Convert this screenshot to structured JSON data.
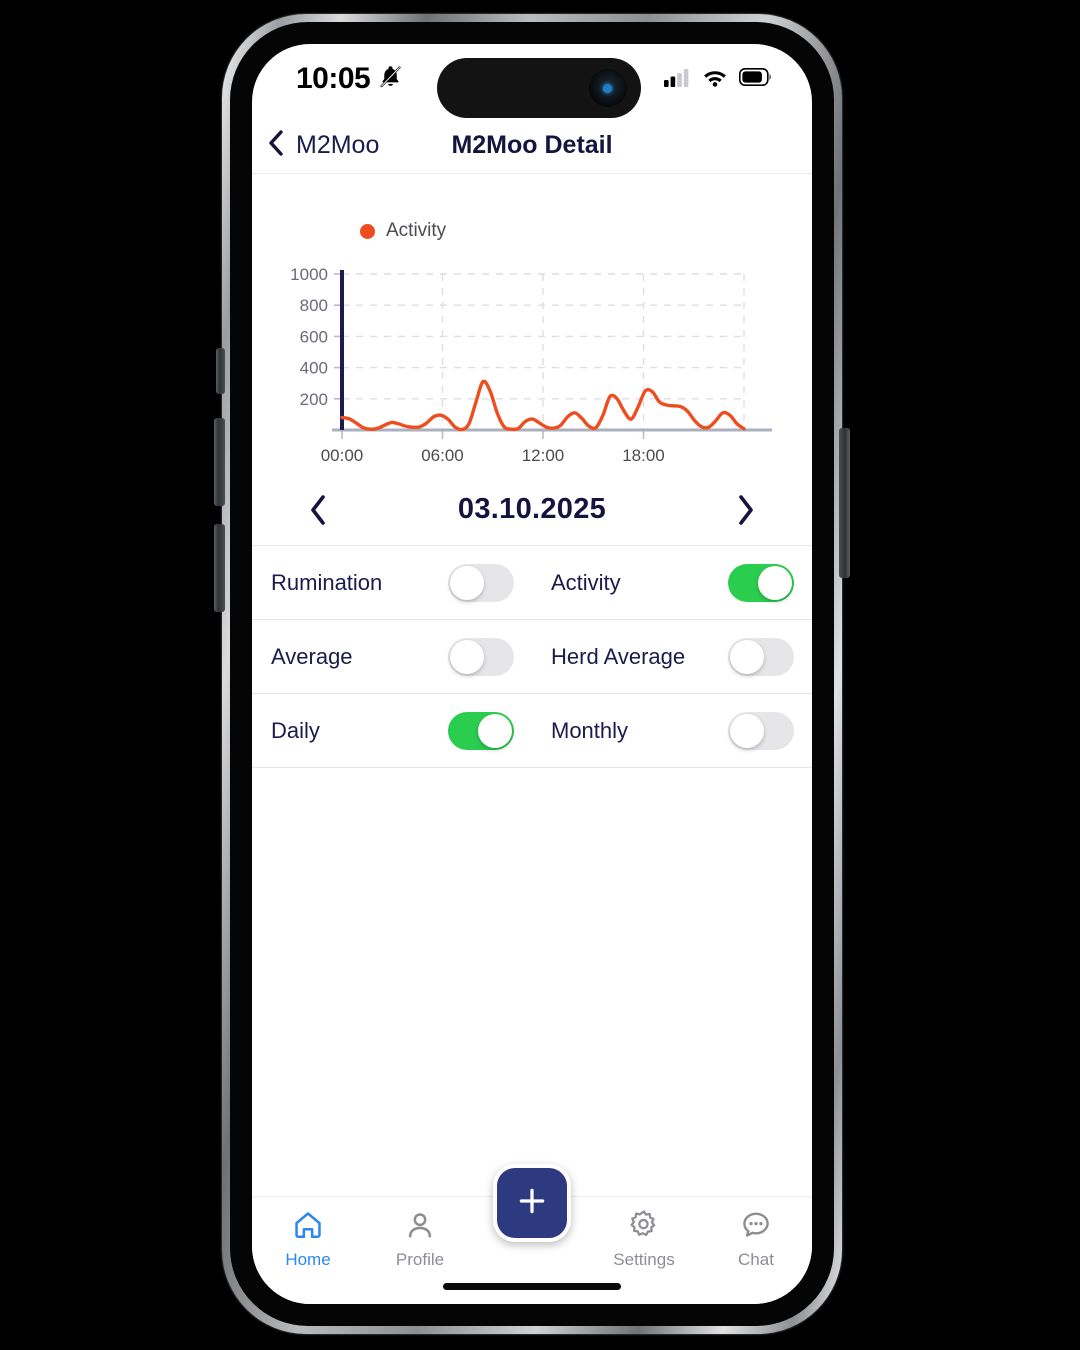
{
  "status_bar": {
    "time": "10:05",
    "bell_icon": "bell-muted-icon",
    "signal_icon": "cellular-signal-icon",
    "wifi_icon": "wifi-icon",
    "battery_icon": "battery-icon"
  },
  "nav": {
    "back_icon": "chevron-left-icon",
    "back_label": "M2Moo",
    "title": "M2Moo Detail"
  },
  "chart_card": {
    "legend_label": "Activity",
    "legend_color": "#ee4d1f"
  },
  "date_selector": {
    "prev_icon": "chevron-left-icon",
    "next_icon": "chevron-right-icon",
    "date": "03.10.2025"
  },
  "toggles": {
    "rows": [
      {
        "left": {
          "label": "Rumination",
          "on": false
        },
        "right": {
          "label": "Activity",
          "on": true
        }
      },
      {
        "left": {
          "label": "Average",
          "on": false
        },
        "right": {
          "label": "Herd Average",
          "on": false
        }
      },
      {
        "left": {
          "label": "Daily",
          "on": true
        },
        "right": {
          "label": "Monthly",
          "on": false
        }
      }
    ],
    "on_color": "#2bcd4f",
    "off_color": "#e6e6e8"
  },
  "tab_bar": {
    "items": [
      {
        "label": "Home",
        "icon": "home-icon",
        "active": true
      },
      {
        "label": "Profile",
        "icon": "person-icon",
        "active": false
      },
      {
        "label": "",
        "icon": "plus-icon",
        "active": false
      },
      {
        "label": "Settings",
        "icon": "gear-icon",
        "active": false
      },
      {
        "label": "Chat",
        "icon": "chat-bubble-icon",
        "active": false
      }
    ],
    "active_color": "#2e86f0",
    "inactive_color": "#8d8d96",
    "fab_color": "#2d3a80",
    "fab_icon": "plus-icon"
  },
  "chart_data": {
    "type": "line",
    "title": "",
    "xlabel": "",
    "ylabel": "",
    "series": [
      {
        "name": "Activity",
        "color": "#ee4d1f",
        "values": [
          80,
          72,
          45,
          15,
          5,
          10,
          30,
          48,
          40,
          25,
          18,
          20,
          45,
          85,
          95,
          70,
          20,
          3,
          40,
          180,
          310,
          250,
          110,
          20,
          5,
          10,
          55,
          70,
          45,
          18,
          12,
          30,
          85,
          110,
          75,
          25,
          15,
          95,
          215,
          200,
          120,
          70,
          150,
          250,
          245,
          180,
          160,
          155,
          150,
          120,
          60,
          20,
          18,
          60,
          110,
          95,
          40,
          8
        ]
      }
    ],
    "x": [
      "00:00",
      "00:25",
      "00:50",
      "01:15",
      "01:40",
      "02:05",
      "02:30",
      "02:55",
      "03:20",
      "03:45",
      "04:10",
      "04:35",
      "05:00",
      "05:25",
      "05:50",
      "06:15",
      "06:40",
      "07:05",
      "07:30",
      "07:55",
      "08:20",
      "08:45",
      "09:10",
      "09:35",
      "10:00",
      "10:25",
      "10:50",
      "11:15",
      "11:40",
      "12:05",
      "12:30",
      "12:55",
      "13:20",
      "13:45",
      "14:10",
      "14:35",
      "15:00",
      "15:25",
      "15:50",
      "16:15",
      "16:40",
      "17:05",
      "17:30",
      "17:55",
      "18:20",
      "18:45",
      "19:10",
      "19:35",
      "20:00",
      "20:25",
      "20:50",
      "21:15",
      "21:40",
      "22:05",
      "22:30",
      "22:55",
      "23:20",
      "23:45"
    ],
    "ytick_labels": [
      "1000",
      "800",
      "600",
      "400",
      "200"
    ],
    "ytick_values": [
      1000,
      800,
      600,
      400,
      200
    ],
    "xtick_labels": [
      "00:00",
      "06:00",
      "12:00",
      "18:00"
    ],
    "xtick_values": [
      0,
      6,
      12,
      18
    ],
    "ylim": [
      0,
      1000
    ],
    "xlim": [
      0,
      24
    ],
    "grid": true,
    "legend_position": "top-left",
    "axis_color": "#1b1b4d",
    "grid_color": "#dedee4"
  }
}
